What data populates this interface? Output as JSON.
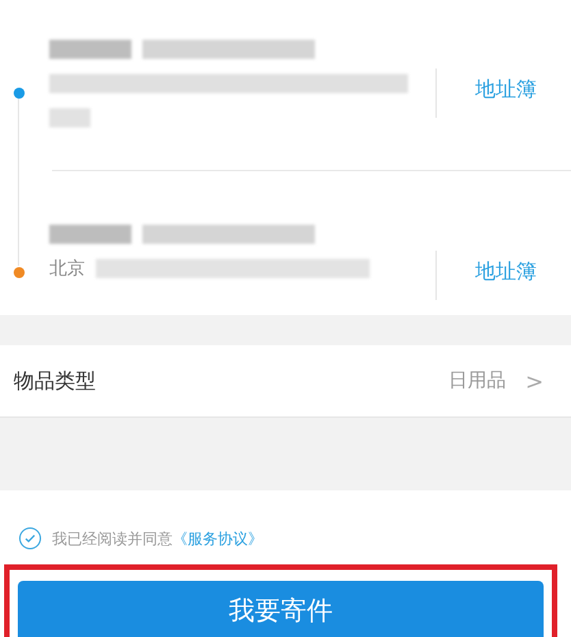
{
  "addresses": [
    {
      "color": "#1a9be6",
      "link": "地址簿"
    },
    {
      "color": "#f08a24",
      "address_prefix": "北京",
      "link": "地址簿"
    }
  ],
  "item_type": {
    "label": "物品类型",
    "value": "日用品",
    "chevron": ">"
  },
  "agreement": {
    "checked": true,
    "text": "我已经阅读并同意",
    "link": "《服务协议》"
  },
  "submit_button": {
    "label": "我要寄件",
    "highlighted": true
  }
}
